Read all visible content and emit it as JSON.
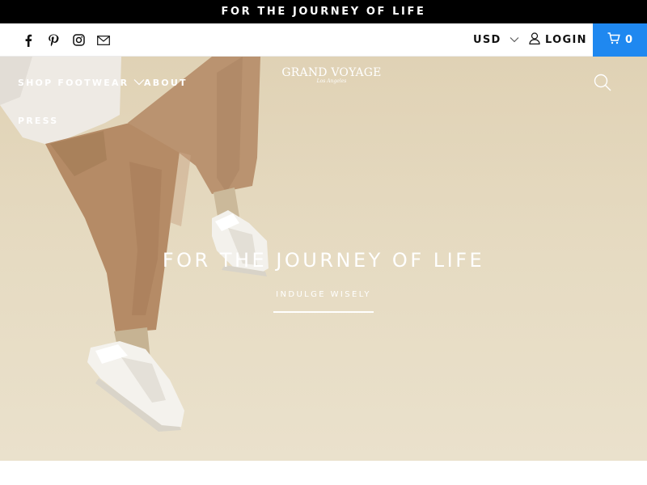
{
  "announcement": {
    "text": "FOR THE JOURNEY OF LIFE"
  },
  "header": {
    "socials": [
      "facebook-icon",
      "pinterest-icon",
      "instagram-icon",
      "mail-icon"
    ],
    "currency": "USD",
    "login_label": "LOGIN",
    "cart_count": "0",
    "cart_color": "#1f88f0"
  },
  "nav": {
    "shop_footwear": "SHOP FOOTWEAR",
    "about": "ABOUT",
    "press": "PRESS"
  },
  "logo": {
    "brand": "GRAND VOYAGE",
    "sub": "Los Angeles"
  },
  "hero": {
    "title": "FOR THE JOURNEY OF LIFE",
    "subtitle": "INDULGE WISELY"
  }
}
